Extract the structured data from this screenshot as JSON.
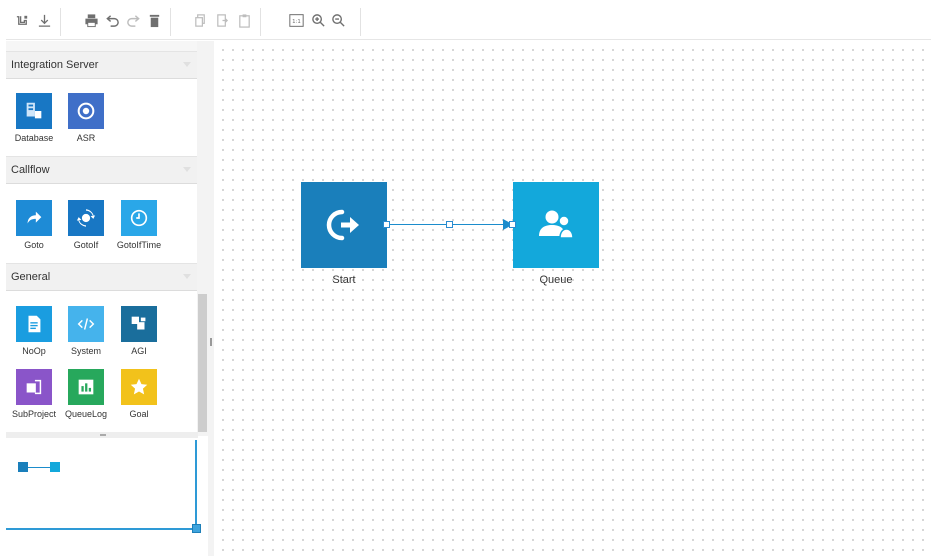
{
  "toolbar": {
    "buttons": [
      {
        "icon": "save-icon"
      },
      {
        "icon": "download-icon"
      },
      {
        "icon": "print-icon"
      },
      {
        "icon": "undo-icon"
      },
      {
        "icon": "redo-icon"
      },
      {
        "icon": "delete-icon"
      },
      {
        "icon": "copy-icon"
      },
      {
        "icon": "cut-icon"
      },
      {
        "icon": "paste-icon"
      },
      {
        "icon": "actual-size-icon",
        "text": "1:1"
      },
      {
        "icon": "zoom-in-icon"
      },
      {
        "icon": "zoom-out-icon"
      }
    ]
  },
  "palette": {
    "sections": [
      {
        "title": "Integration Server",
        "items": [
          {
            "label": "Database",
            "icon": "database-icon",
            "color": "#1877c4"
          },
          {
            "label": "ASR",
            "icon": "asr-icon",
            "color": "#3f6fc8"
          }
        ]
      },
      {
        "title": "Callflow",
        "items": [
          {
            "label": "Goto",
            "icon": "goto-icon",
            "color": "#1e8bd6"
          },
          {
            "label": "GotoIf",
            "icon": "gotoif-icon",
            "color": "#1877c4"
          },
          {
            "label": "GotoIfTime",
            "icon": "clock-icon",
            "color": "#2aa7e8"
          }
        ]
      },
      {
        "title": "General",
        "items": [
          {
            "label": "NoOp",
            "icon": "document-icon",
            "color": "#1a9de0"
          },
          {
            "label": "System",
            "icon": "code-icon",
            "color": "#45b3ec"
          },
          {
            "label": "AGI",
            "icon": "agi-icon",
            "color": "#1a6e9c"
          },
          {
            "label": "SubProject",
            "icon": "subproject-icon",
            "color": "#8a55c9"
          },
          {
            "label": "QueueLog",
            "icon": "chart-icon",
            "color": "#27a85c"
          },
          {
            "label": "Goal",
            "icon": "star-icon",
            "color": "#f2c21b"
          }
        ]
      }
    ]
  },
  "canvas": {
    "nodes": [
      {
        "label": "Start",
        "icon": "start-icon",
        "color": "#1a7fbb"
      },
      {
        "label": "Queue",
        "icon": "users-icon",
        "color": "#13a8db"
      }
    ]
  },
  "colors": {
    "edge": "#1b8ccc",
    "outline_border": "#2e9ad6"
  }
}
